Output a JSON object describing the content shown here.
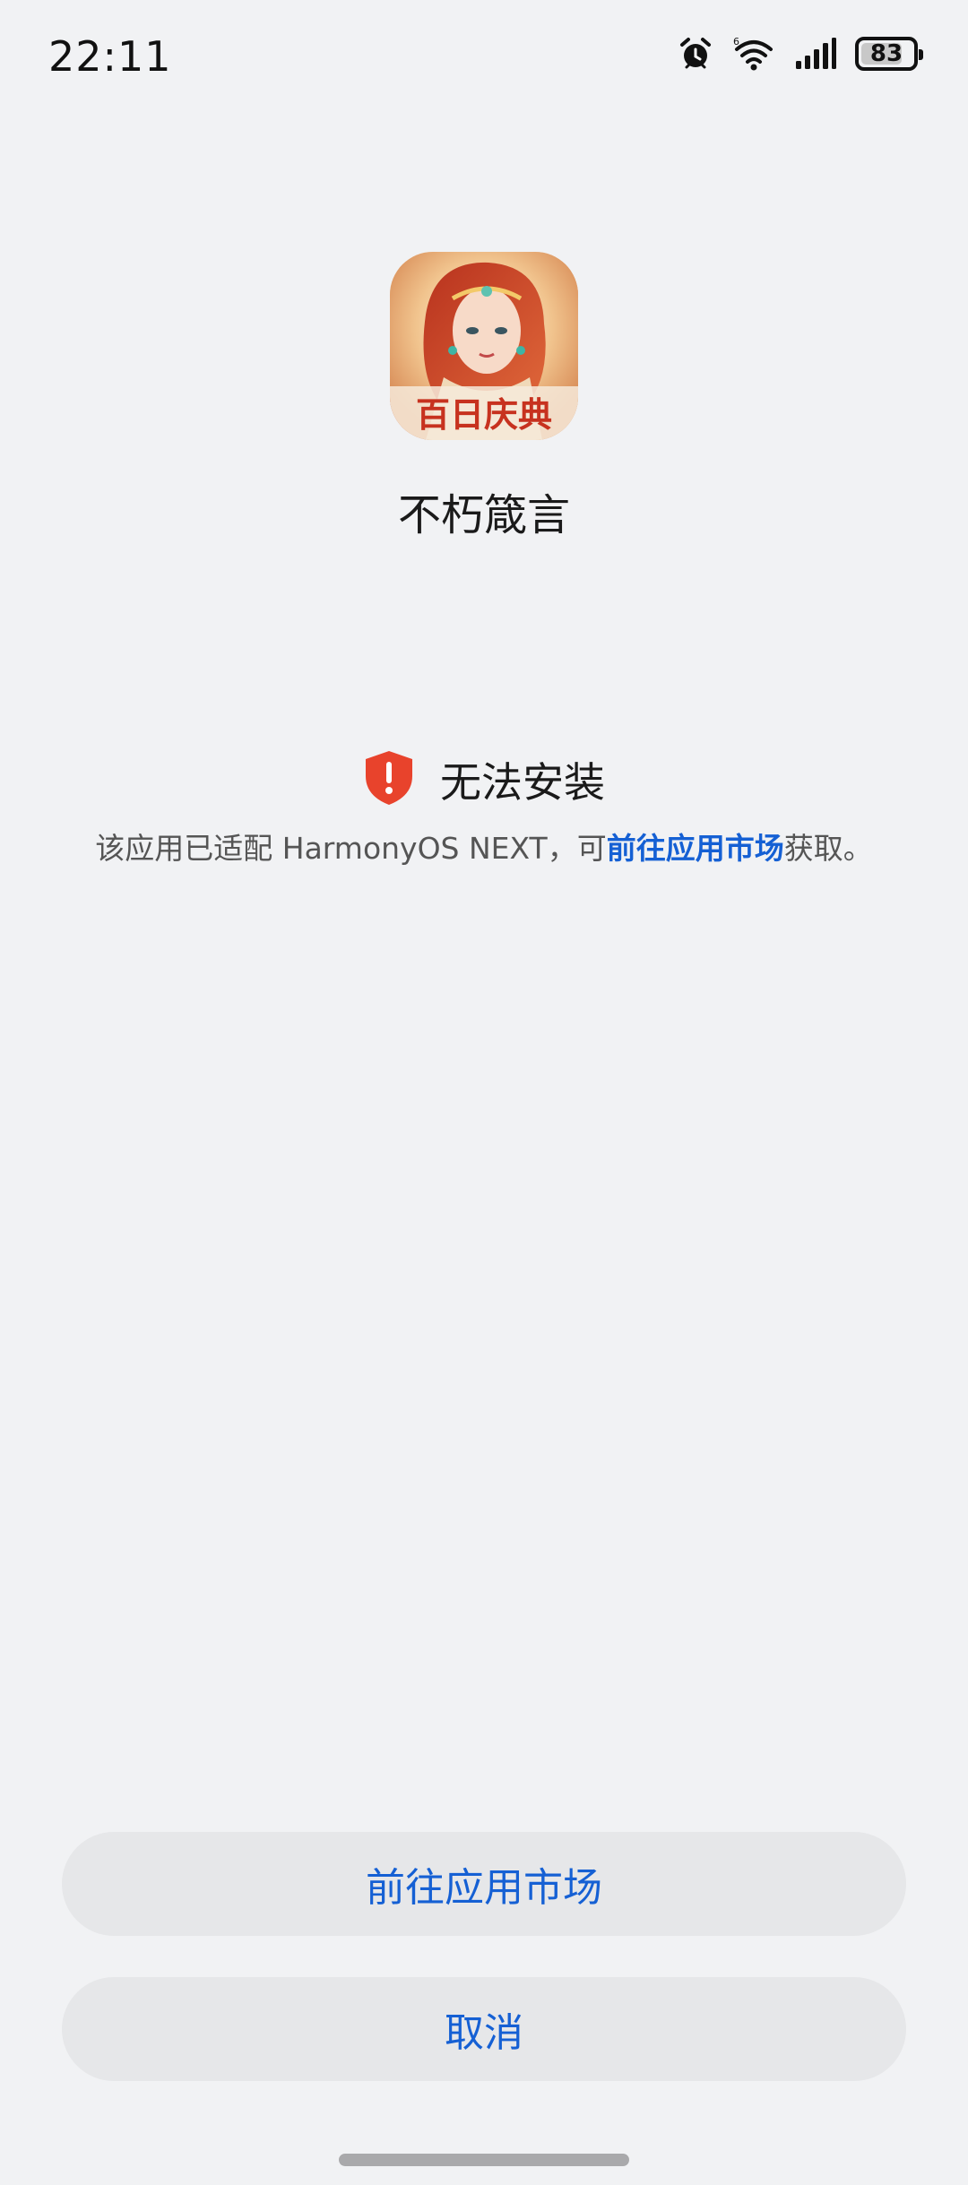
{
  "status_bar": {
    "time": "22:11",
    "battery_level": "83",
    "battery_fraction": 0.83,
    "icons": [
      "alarm-icon",
      "wifi-icon",
      "signal-icon",
      "battery-icon"
    ]
  },
  "app": {
    "name": "不朽箴言",
    "icon_banner_text": "百日庆典"
  },
  "warning": {
    "title": "无法安装",
    "desc_before": "该应用已适配 HarmonyOS NEXT，可",
    "desc_link": "前往应用市场",
    "desc_after": "获取。",
    "icon": "shield-alert-icon",
    "icon_color": "#e8432c"
  },
  "buttons": {
    "market_label": "前往应用市场",
    "cancel_label": "取消"
  },
  "colors": {
    "accent": "#1560d4",
    "background": "#f1f2f4",
    "button_bg": "#e6e7e9"
  }
}
